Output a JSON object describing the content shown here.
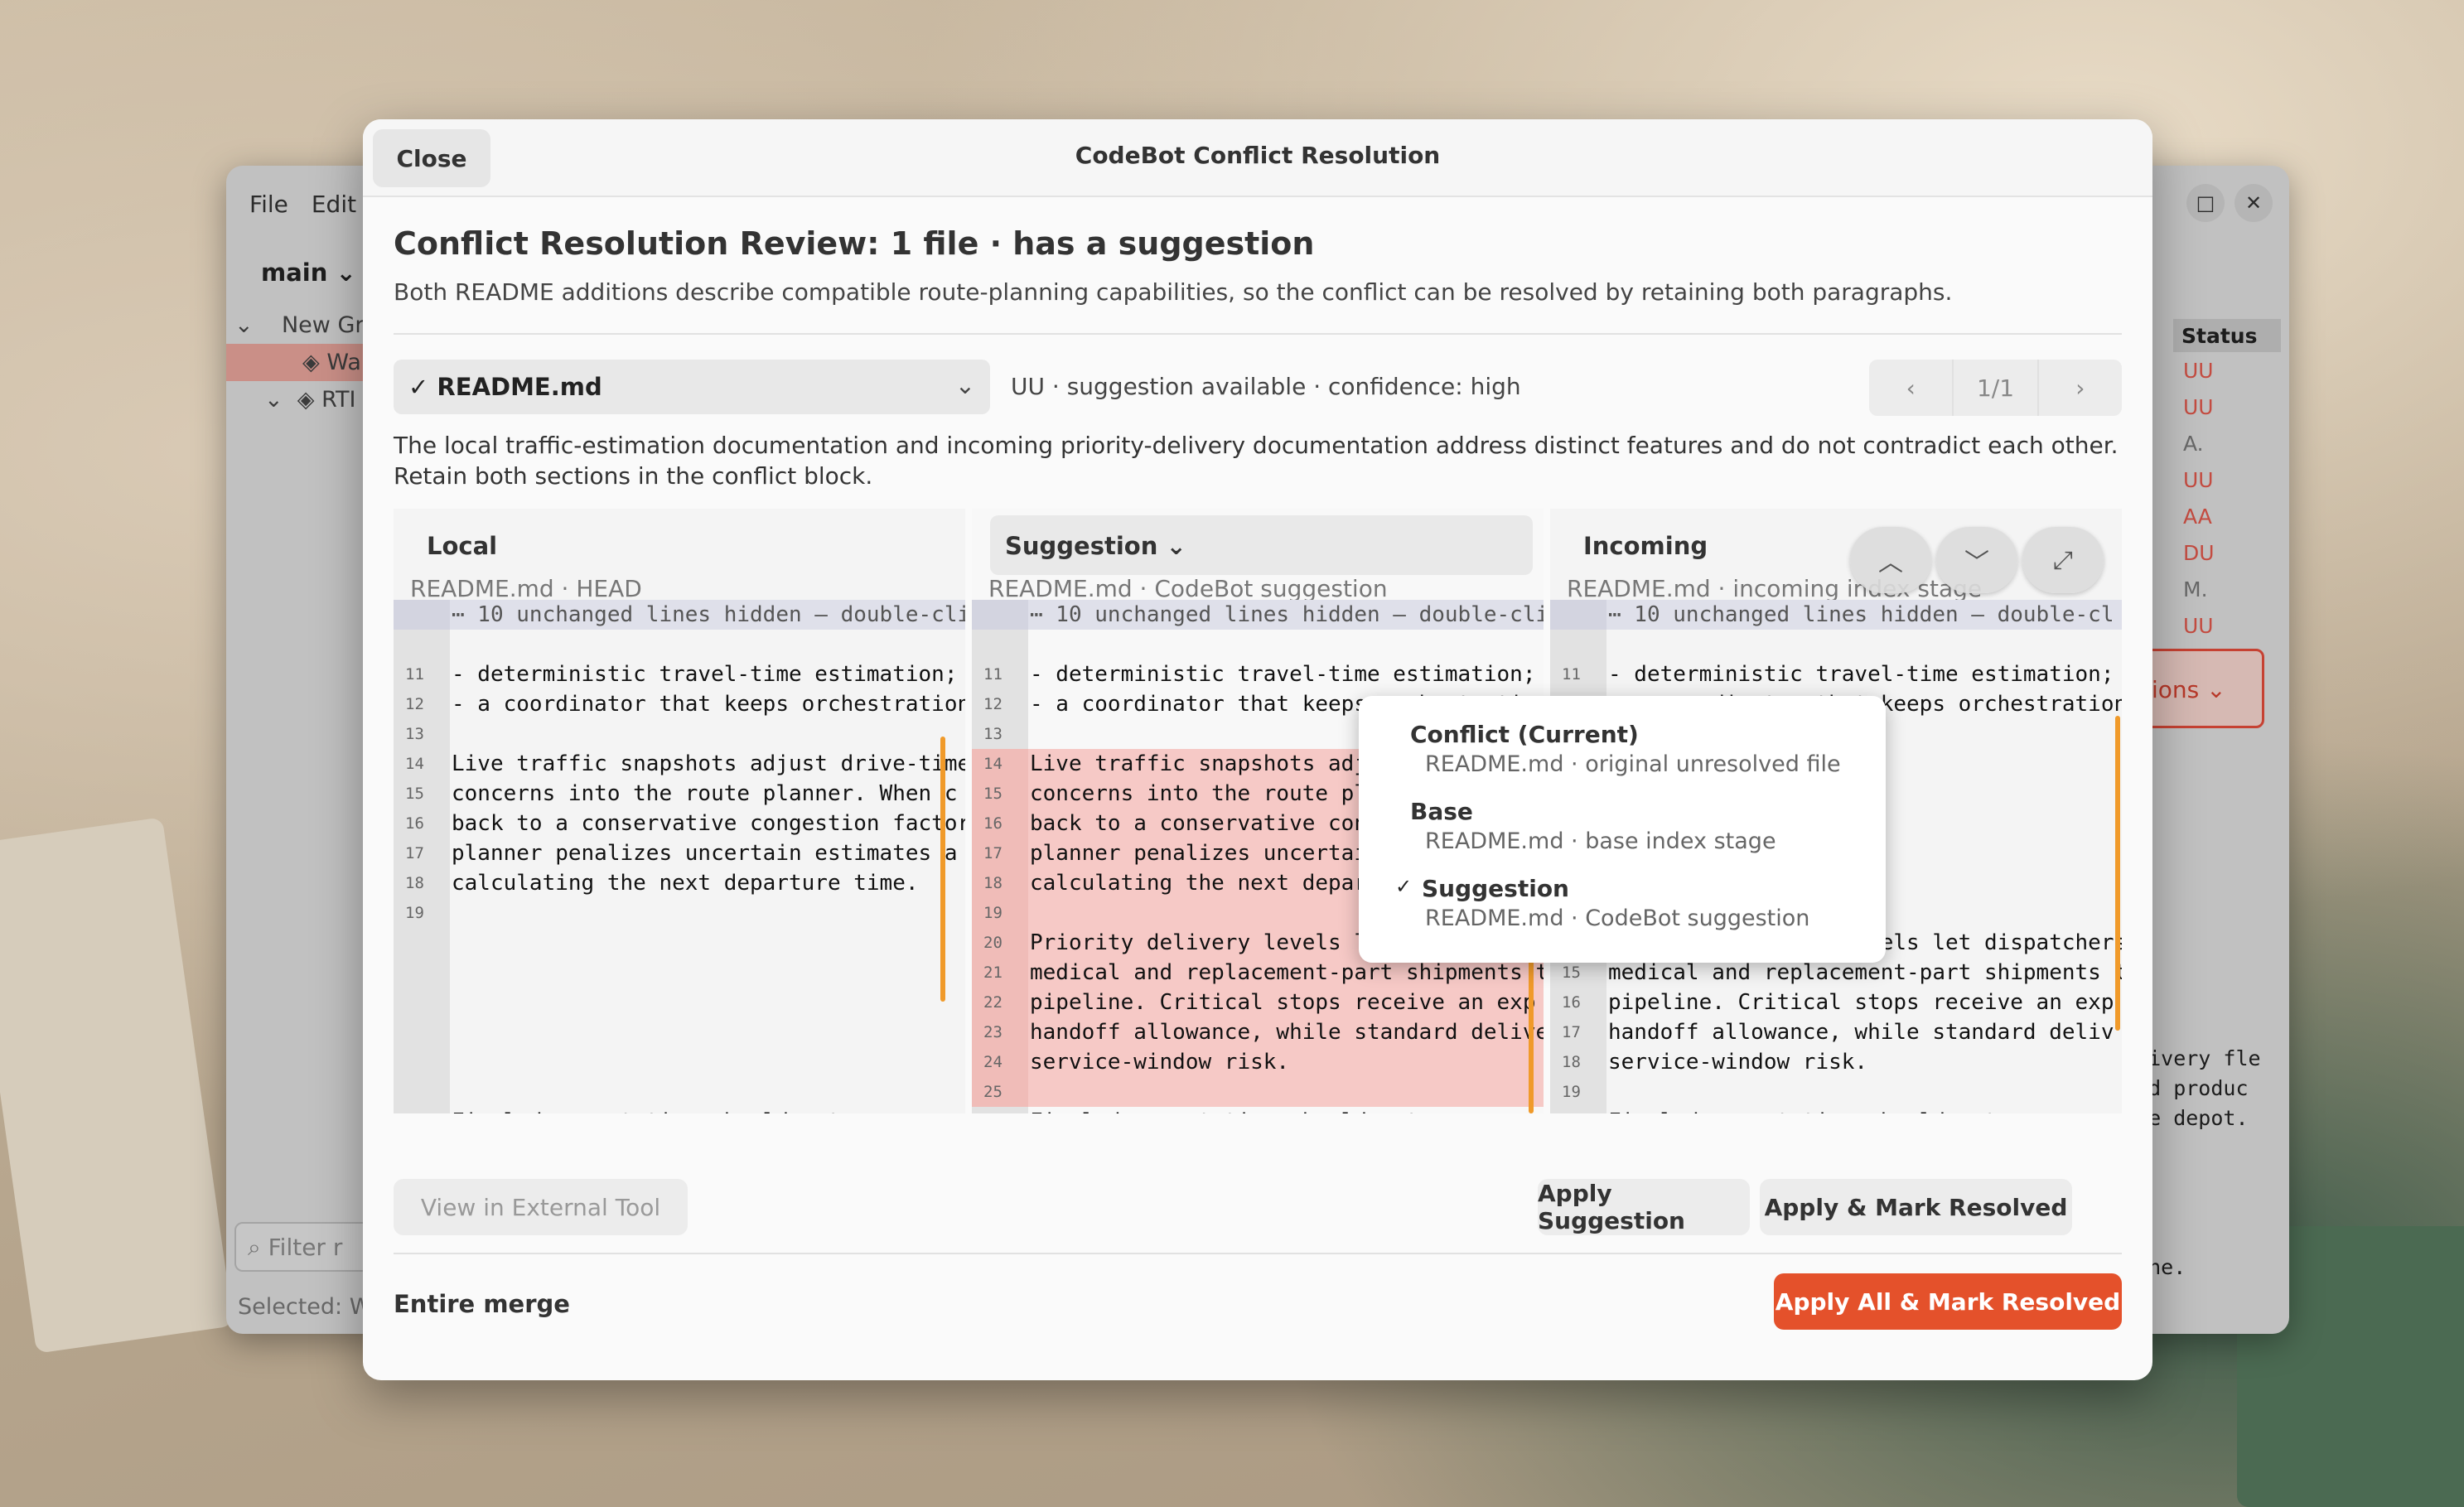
{
  "background_app": {
    "menu": [
      "File",
      "Edit"
    ],
    "branch": "main",
    "tree": [
      "New Gr",
      "Wa",
      "RTI"
    ],
    "status_header": "Status",
    "statuses": [
      "UU",
      "UU",
      "A.",
      "UU",
      "AA",
      "DU",
      "M.",
      "UU"
    ],
    "actions_label": "tions",
    "filter_placeholder": "Filter r",
    "selected_text": "Selected: W",
    "right_code": [
      "elivery fle",
      "and produc",
      "the depot.",
      "",
      "",
      "",
      "",
      "gine."
    ]
  },
  "dialog": {
    "close_label": "Close",
    "title": "CodeBot Conflict Resolution",
    "review_title": "Conflict Resolution Review: 1 file · has a suggestion",
    "review_subtitle": "Both README additions describe compatible route-planning capabilities, so the conflict can be resolved by retaining both paragraphs.",
    "file": {
      "name": "README.md",
      "meta": "UU · suggestion available · confidence: high"
    },
    "pager": {
      "prev": "‹",
      "position": "1/1",
      "next": "›"
    },
    "explanation": "The local traffic-estimation documentation and incoming priority-delivery documentation address distinct features and do not contradict each other. Retain both sections in the conflict block.",
    "panes": {
      "local": {
        "title": "Local",
        "subtitle": "README.md · HEAD",
        "rows": [
          {
            "ln": "",
            "text": "⋯ 10 unchanged lines hidden — double-click",
            "kind": "hidden"
          },
          {
            "ln": "",
            "text": "",
            "kind": "blank"
          },
          {
            "ln": "11",
            "text": "- deterministic travel-time estimation;",
            "kind": "normal"
          },
          {
            "ln": "12",
            "text": "- a coordinator that keeps orchestration",
            "kind": "normal"
          },
          {
            "ln": "13",
            "text": "",
            "kind": "normal"
          },
          {
            "ln": "14",
            "text": "Live traffic snapshots adjust drive-time",
            "kind": "normal"
          },
          {
            "ln": "15",
            "text": "concerns into the route planner. When c",
            "kind": "normal"
          },
          {
            "ln": "16",
            "text": "back to a conservative congestion factor",
            "kind": "normal"
          },
          {
            "ln": "17",
            "text": "planner penalizes uncertain estimates a",
            "kind": "normal"
          },
          {
            "ln": "18",
            "text": "calculating the next departure time.",
            "kind": "normal"
          },
          {
            "ln": "19",
            "text": "",
            "kind": "normal"
          },
          {
            "ln": "",
            "text": "",
            "kind": "blank"
          },
          {
            "ln": "",
            "text": "",
            "kind": "blank"
          },
          {
            "ln": "",
            "text": "",
            "kind": "blank"
          },
          {
            "ln": "",
            "text": "",
            "kind": "blank"
          },
          {
            "ln": "",
            "text": "",
            "kind": "blank"
          },
          {
            "ln": "",
            "text": "",
            "kind": "blank"
          },
          {
            "ln": "",
            "text": "Final documentation should note",
            "kind": "normal"
          }
        ]
      },
      "suggestion": {
        "title": "Suggestion ⌄",
        "subtitle": "README.md · CodeBot suggestion",
        "rows": [
          {
            "ln": "",
            "text": "⋯ 10 unchanged lines hidden — double-cli",
            "kind": "hidden"
          },
          {
            "ln": "",
            "text": "",
            "kind": "blank"
          },
          {
            "ln": "11",
            "text": "- deterministic travel-time estimation;",
            "kind": "normal"
          },
          {
            "ln": "12",
            "text": "- a coordinator that keeps orchestration",
            "kind": "normal"
          },
          {
            "ln": "13",
            "text": "",
            "kind": "normal"
          },
          {
            "ln": "14",
            "text": "Live traffic snapshots adjust drive-tim",
            "kind": "add"
          },
          {
            "ln": "15",
            "text": "concerns into the route planner. When c",
            "kind": "add"
          },
          {
            "ln": "16",
            "text": "back to a conservative congestion factor",
            "kind": "add"
          },
          {
            "ln": "17",
            "text": "planner penalizes uncertain estimates a",
            "kind": "add"
          },
          {
            "ln": "18",
            "text": "calculating the next departure time.",
            "kind": "add"
          },
          {
            "ln": "19",
            "text": "",
            "kind": "add"
          },
          {
            "ln": "20",
            "text": "Priority delivery levels let dispatchers",
            "kind": "add"
          },
          {
            "ln": "21",
            "text": "medical and replacement-part shipments t",
            "kind": "add"
          },
          {
            "ln": "22",
            "text": "pipeline. Critical stops receive an exp",
            "kind": "add"
          },
          {
            "ln": "23",
            "text": "handoff allowance, while standard delive",
            "kind": "add"
          },
          {
            "ln": "24",
            "text": "service-window risk.",
            "kind": "add"
          },
          {
            "ln": "25",
            "text": "",
            "kind": "add"
          },
          {
            "ln": "",
            "text": "Final documentation should note",
            "kind": "normal"
          }
        ]
      },
      "incoming": {
        "title": "Incoming",
        "subtitle": "README.md · incoming index stage",
        "rows": [
          {
            "ln": "",
            "text": "⋯ 10 unchanged lines hidden — double-cl",
            "kind": "hidden"
          },
          {
            "ln": "",
            "text": "",
            "kind": "blank"
          },
          {
            "ln": "11",
            "text": "- deterministic travel-time estimation;",
            "kind": "normal"
          },
          {
            "ln": "12",
            "text": "- a coordinator that keeps orchestration",
            "kind": "normal"
          },
          {
            "ln": "13",
            "text": "",
            "kind": "normal"
          },
          {
            "ln": "",
            "text": "",
            "kind": "blank"
          },
          {
            "ln": "",
            "text": "",
            "kind": "blank"
          },
          {
            "ln": "",
            "text": "",
            "kind": "blank"
          },
          {
            "ln": "",
            "text": "",
            "kind": "blank"
          },
          {
            "ln": "",
            "text": "",
            "kind": "blank"
          },
          {
            "ln": "",
            "text": "",
            "kind": "blank"
          },
          {
            "ln": "14",
            "text": "Priority delivery levels let dispatchers",
            "kind": "normal"
          },
          {
            "ln": "15",
            "text": "medical and replacement-part shipments t",
            "kind": "normal"
          },
          {
            "ln": "16",
            "text": "pipeline. Critical stops receive an exp",
            "kind": "normal"
          },
          {
            "ln": "17",
            "text": "handoff allowance, while standard deliv",
            "kind": "normal"
          },
          {
            "ln": "18",
            "text": "service-window risk.",
            "kind": "normal"
          },
          {
            "ln": "19",
            "text": "",
            "kind": "normal"
          },
          {
            "ln": "",
            "text": "Final documentation should note",
            "kind": "normal"
          }
        ]
      }
    },
    "dropdown": [
      {
        "title": "Conflict (Current)",
        "sub": "README.md · original unresolved file",
        "checked": false
      },
      {
        "title": "Base",
        "sub": "README.md · base index stage",
        "checked": false
      },
      {
        "title": "Suggestion",
        "sub": "README.md · CodeBot suggestion",
        "checked": true
      }
    ],
    "buttons": {
      "external": "View in External Tool",
      "apply_suggestion": "Apply Suggestion",
      "apply_mark": "Apply & Mark Resolved",
      "entire_merge": "Entire merge",
      "apply_all": "Apply All & Mark Resolved"
    },
    "colors": {
      "accent": "#e4512b",
      "conflict_bar": "#f09a2a",
      "added_line": "#f6c9c6"
    }
  }
}
